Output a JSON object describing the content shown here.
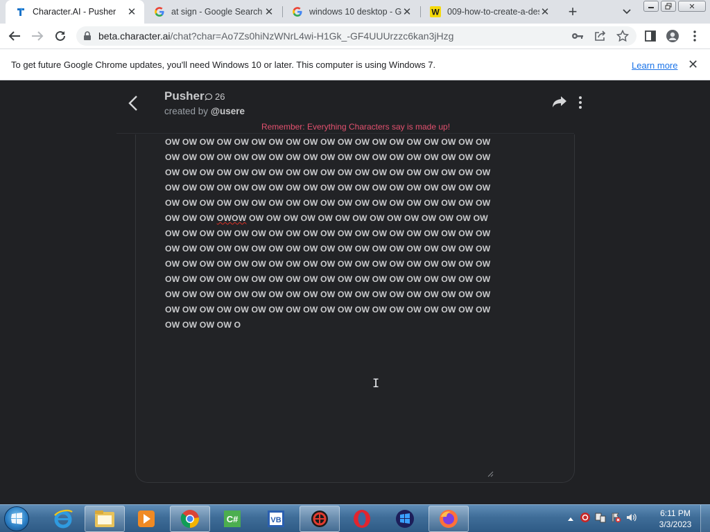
{
  "browser": {
    "tabs": [
      {
        "title": "Character.AI - Pusher",
        "icon": "character-ai-icon",
        "active": true
      },
      {
        "title": "at sign - Google Search",
        "icon": "google-icon",
        "active": false
      },
      {
        "title": "windows 10 desktop - Go",
        "icon": "google-icon",
        "active": false
      },
      {
        "title": "009-how-to-create-a-des",
        "icon": "w-site-icon",
        "active": false
      }
    ],
    "url_host": "beta.character.ai",
    "url_path": "/chat?char=Ao7Zs0hiNzWNrL4wi-H1Gk_-GF4UUUrzzc6kan3jHzg"
  },
  "infobar": {
    "message": "To get future Google Chrome updates, you'll need Windows 10 or later. This computer is using Windows 7.",
    "link": "Learn more"
  },
  "chat": {
    "character_name": "Pusher",
    "chat_count": "26",
    "created_by_prefix": "created by",
    "creator": "@usere",
    "notice": "Remember: Everything Characters say is made up!",
    "message_lines": [
      "OW OW OW OW OW OW OW OW OW OW OW OW OW OW OW OW OW OW OW",
      "OW OW OW OW OW OW OW OW OW OW OW OW OW OW OW OW OW OW OW",
      "OW OW OW OW OW OW OW OW OW OW OW OW OW OW OW OW OW OW OW",
      "OW OW OW OW OW OW OW OW OW OW OW OW OW OW OW OW OW OW OW",
      "OW OW OW OW OW OW OW OW OW OW OW OW OW OW OW OW OW OW OW",
      "OW OW OW |OWOW| OW OW OW OW OW OW OW OW OW OW OW OW OW OW",
      "OW OW OW OW OW OW OW OW OW OW OW OW OW OW OW OW OW OW OW",
      "OW OW OW OW OW OW OW OW OW OW OW OW OW OW OW OW OW OW OW",
      "OW OW OW OW OW OW OW OW OW OW OW OW OW OW OW OW OW OW OW",
      "OW OW OW OW OW OW OW OW OW OW OW OW OW OW OW OW OW OW OW",
      "OW OW OW OW OW OW OW OW OW OW OW OW OW OW OW OW OW OW OW",
      "OW OW OW OW OW OW OW OW OW OW OW OW OW OW OW OW OW OW OW",
      "OW OW OW OW O"
    ]
  },
  "taskbar": {
    "pinned": [
      "internet-explorer-icon",
      "file-explorer-icon",
      "media-player-icon",
      "chrome-icon",
      "csharp-icon",
      "visual-basic-icon",
      "app-red-icon",
      "opera-icon",
      "app-blue-icon",
      "firefox-icon"
    ],
    "time": "6:11 PM",
    "date": "3/3/2023"
  },
  "colors": {
    "page_bg": "#202124",
    "notice": "#e3516f",
    "text": "#c9cacc",
    "link": "#1a73e8"
  }
}
